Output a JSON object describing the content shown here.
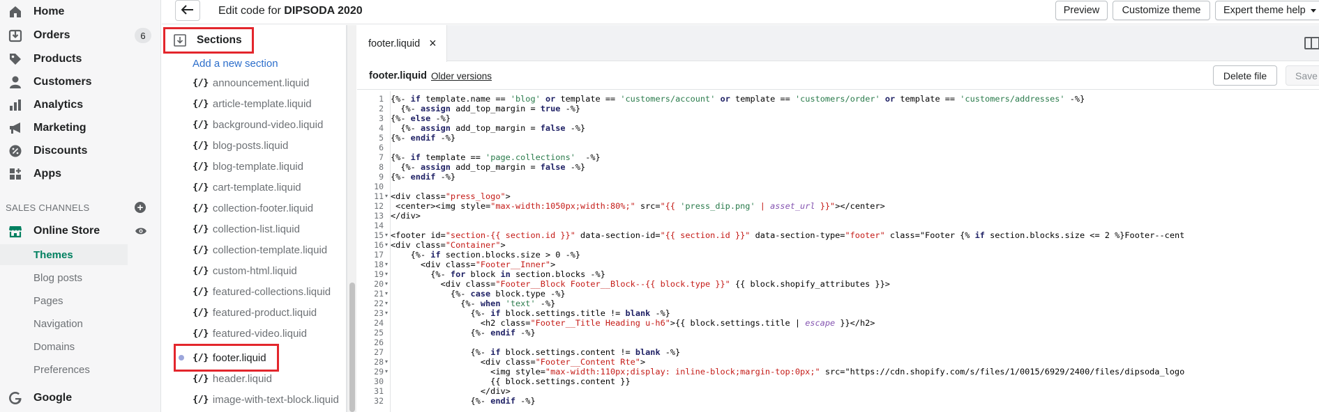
{
  "nav": {
    "items": [
      {
        "label": "Home",
        "icon": "home-icon"
      },
      {
        "label": "Orders",
        "icon": "orders-icon",
        "badge": "6"
      },
      {
        "label": "Products",
        "icon": "tag-icon"
      },
      {
        "label": "Customers",
        "icon": "person-icon"
      },
      {
        "label": "Analytics",
        "icon": "bar-chart-icon"
      },
      {
        "label": "Marketing",
        "icon": "megaphone-icon"
      },
      {
        "label": "Discounts",
        "icon": "discount-icon"
      },
      {
        "label": "Apps",
        "icon": "apps-icon"
      }
    ],
    "sales_channels_heading": "SALES CHANNELS",
    "online_store": {
      "label": "Online Store",
      "icon": "store-icon"
    },
    "sub_items": [
      "Themes",
      "Blog posts",
      "Pages",
      "Navigation",
      "Domains",
      "Preferences"
    ],
    "active_sub_item": "Themes",
    "google": {
      "label": "Google",
      "icon": "google-icon"
    }
  },
  "topbar": {
    "title_prefix": "Edit code for ",
    "theme_name": "DIPSODA 2020",
    "preview_label": "Preview",
    "customize_label": "Customize theme",
    "help_label": "Expert theme help"
  },
  "tree": {
    "folder_label": "Sections",
    "add_link": "Add a new section",
    "liquid_glyph": "{/}",
    "files": [
      "announcement.liquid",
      "article-template.liquid",
      "background-video.liquid",
      "blog-posts.liquid",
      "blog-template.liquid",
      "cart-template.liquid",
      "collection-footer.liquid",
      "collection-list.liquid",
      "collection-template.liquid",
      "custom-html.liquid",
      "featured-collections.liquid",
      "featured-product.liquid",
      "featured-video.liquid",
      "footer.liquid",
      "header.liquid",
      "image-with-text-block.liquid"
    ],
    "selected_file": "footer.liquid"
  },
  "editor": {
    "tab_label": "footer.liquid",
    "file_name": "footer.liquid",
    "older_versions_label": "Older versions",
    "delete_label": "Delete file",
    "save_label": "Save",
    "line_numbers": [
      "1",
      "2",
      "3",
      "4",
      "5",
      "6",
      "7",
      "8",
      "9",
      "10",
      "11",
      "12",
      "13",
      "14",
      "15",
      "16",
      "17",
      "18",
      "19",
      "20",
      "21",
      "22",
      "23",
      "24",
      "25",
      "26",
      "27",
      "28",
      "29",
      "30",
      "31",
      "32"
    ],
    "fold_lines": [
      "11",
      "15",
      "16",
      "18",
      "19",
      "20",
      "21",
      "22",
      "23",
      "28",
      "29"
    ],
    "code_lines": [
      "{%- if template.name == 'blog' or template == 'customers/account' or template == 'customers/order' or template == 'customers/addresses' -%}",
      "  {%- assign add_top_margin = true -%}",
      "{%- else -%}",
      "  {%- assign add_top_margin = false -%}",
      "{%- endif -%}",
      "",
      "{%- if template == 'page.collections'  -%}",
      "  {%- assign add_top_margin = false -%}",
      "{%- endif -%}",
      "",
      "<div class=\"press_logo\">",
      " <center><img style=\"max-width:1050px;width:80%;\" src=\"{{ 'press_dip.png' | asset_url }}\"></center>",
      "</div>",
      "",
      "<footer id=\"section-{{ section.id }}\" data-section-id=\"{{ section.id }}\" data-section-type=\"footer\" class=\"Footer {% if section.blocks.size <= 2 %}Footer--cent",
      "<div class=\"Container\">",
      "    {%- if section.blocks.size > 0 -%}",
      "      <div class=\"Footer__Inner\">",
      "        {%- for block in section.blocks -%}",
      "          <div class=\"Footer__Block Footer__Block--{{ block.type }}\" {{ block.shopify_attributes }}>",
      "            {%- case block.type -%}",
      "              {%- when 'text' -%}",
      "                {%- if block.settings.title != blank -%}",
      "                  <h2 class=\"Footer__Title Heading u-h6\">{{ block.settings.title | escape }}</h2>",
      "                {%- endif -%}",
      "",
      "                {%- if block.settings.content != blank -%}",
      "                  <div class=\"Footer__Content Rte\">",
      "                    <img style=\"max-width:110px;display: inline-block;margin-top:0px;\" src=\"https://cdn.shopify.com/s/files/1/0015/6929/2400/files/dipsoda_logo",
      "                    {{ block.settings.content }}",
      "                  </div>",
      "                {%- endif -%}"
    ]
  },
  "colors": {
    "accent_green": "#008060",
    "link_blue": "#2c6ecb",
    "highlight_red": "#e3262c"
  }
}
